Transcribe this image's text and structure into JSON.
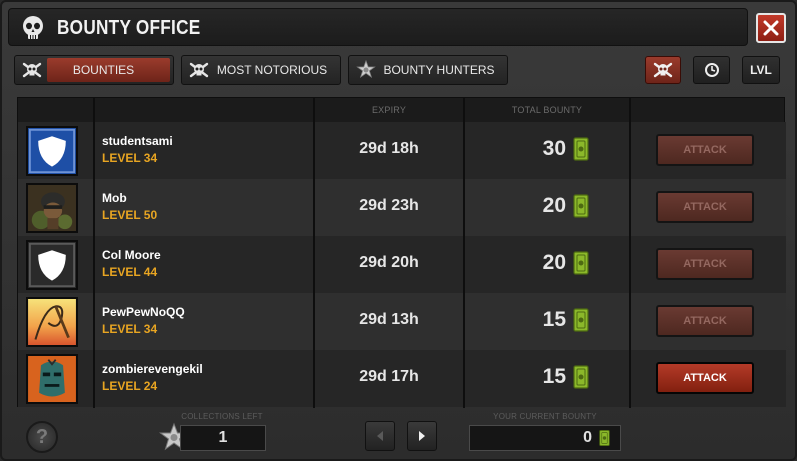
{
  "window": {
    "title": "BOUNTY OFFICE"
  },
  "tabs": [
    {
      "label": "BOUNTIES",
      "icon": "skull-crossbones-icon",
      "active": true
    },
    {
      "label": "MOST NOTORIOUS",
      "icon": "skull-crossbones-icon",
      "active": false
    },
    {
      "label": "BOUNTY HUNTERS",
      "icon": "sheriff-star-icon",
      "active": false
    }
  ],
  "sort_buttons": [
    {
      "icon": "skull-crossbones-icon",
      "active": true
    },
    {
      "icon": "clock-icon",
      "active": false
    },
    {
      "label": "LVL",
      "active": false
    }
  ],
  "table": {
    "headers": {
      "expiry": "EXPIRY",
      "total_bounty": "TOTAL BOUNTY"
    },
    "rows": [
      {
        "name": "studentsami",
        "level": "LEVEL 34",
        "expiry": "29d 18h",
        "bounty": "30",
        "avatar": "white-shield-blue",
        "action": "ATTACK",
        "enabled": false
      },
      {
        "name": "Mob",
        "level": "LEVEL 50",
        "expiry": "29d 23h",
        "bounty": "20",
        "avatar": "soldier-portrait",
        "action": "ATTACK",
        "enabled": false
      },
      {
        "name": "Col Moore",
        "level": "LEVEL 44",
        "expiry": "29d 20h",
        "bounty": "20",
        "avatar": "white-shield-dark",
        "action": "ATTACK",
        "enabled": false
      },
      {
        "name": "PewPewNoQQ",
        "level": "LEVEL 34",
        "expiry": "29d 13h",
        "bounty": "15",
        "avatar": "whip-sunset",
        "action": "ATTACK",
        "enabled": false
      },
      {
        "name": "zombierevengekil",
        "level": "LEVEL 24",
        "expiry": "29d 17h",
        "bounty": "15",
        "avatar": "zombie-head",
        "action": "ATTACK",
        "enabled": true
      }
    ]
  },
  "footer": {
    "collections_left_label": "COLLECTIONS LEFT",
    "collections_left": "1",
    "current_bounty_label": "YOUR CURRENT BOUNTY",
    "current_bounty": "0"
  },
  "colors": {
    "accent_red": "#9a3b2c",
    "level_gold": "#e8a522",
    "bounty_green": "#8bb82a"
  }
}
